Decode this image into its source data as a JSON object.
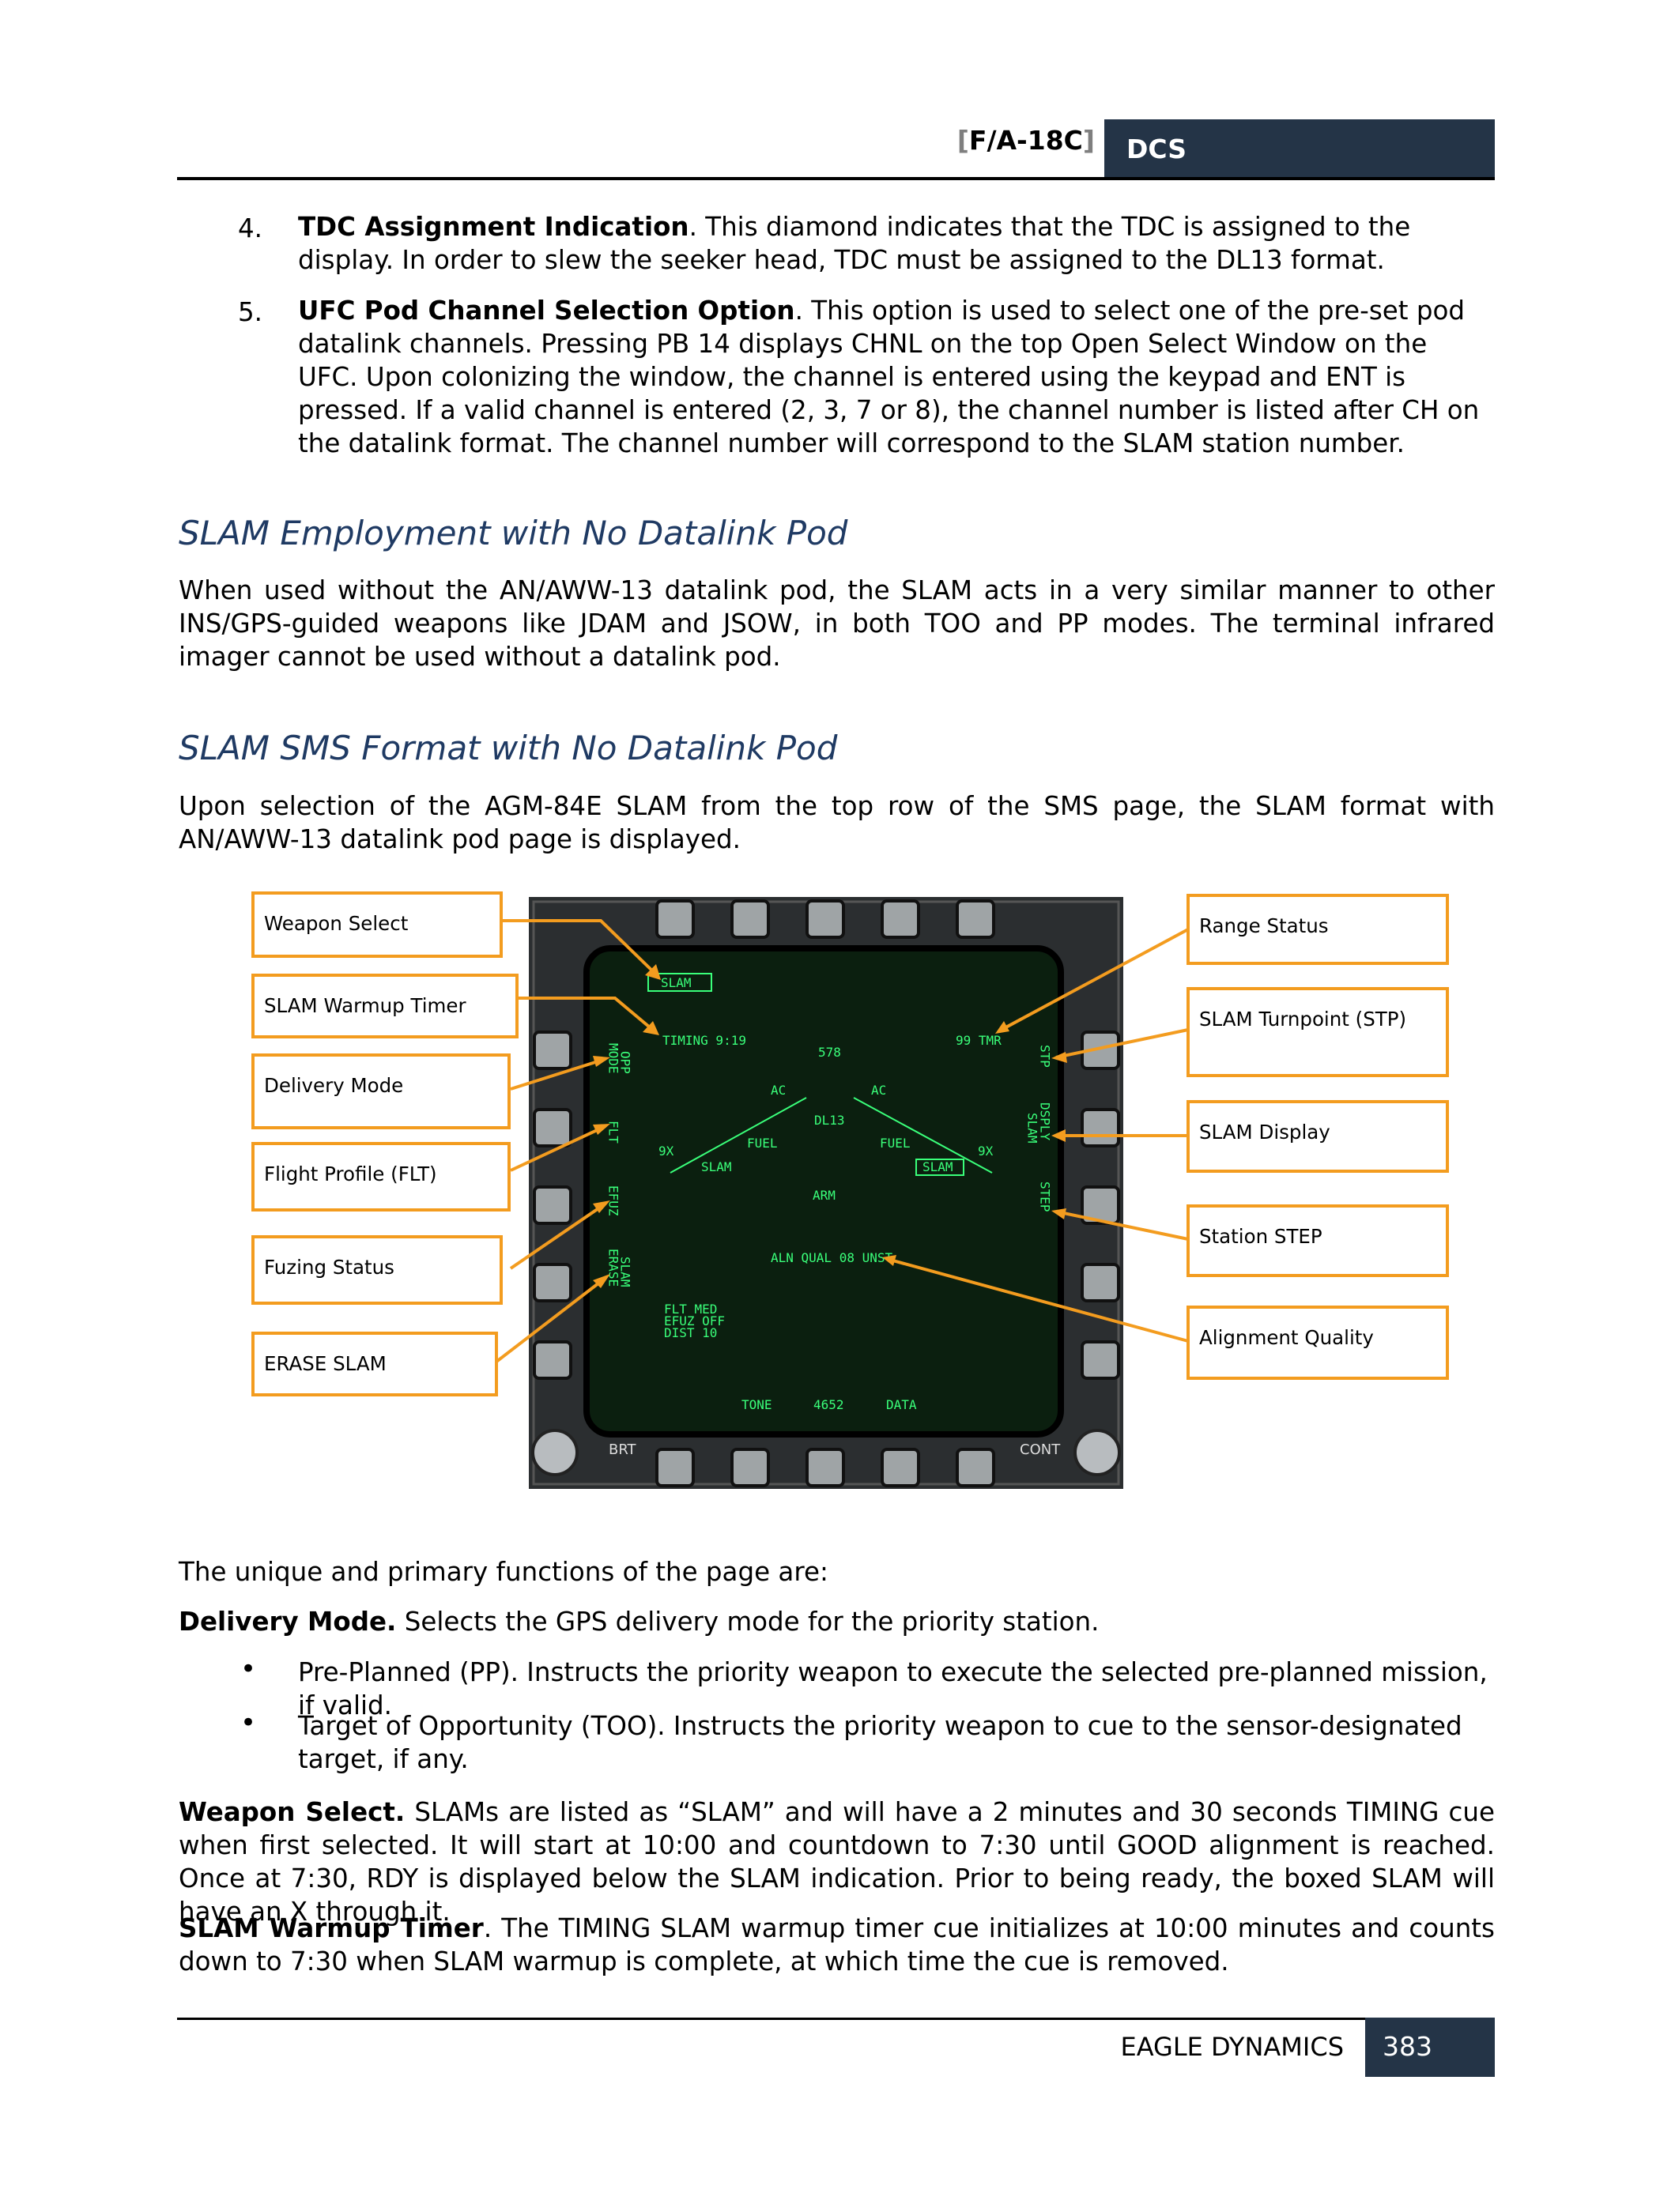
{
  "header": {
    "title": "F/A-18C",
    "bracket_open": "[",
    "bracket_close": "]",
    "badge": "DCS"
  },
  "items": [
    {
      "num": "4.",
      "bold": "TDC Assignment Indication",
      "text": ". This diamond indicates that the TDC is assigned to the display. In order to slew the seeker head, TDC must be assigned to the DL13 format."
    },
    {
      "num": "5.",
      "bold": "UFC Pod Channel Selection Option",
      "text": ". This option is used to select one of the pre-set pod datalink channels. Pressing PB 14 displays CHNL on the top Open Select Window on the UFC. Upon colonizing the window, the channel is entered using the keypad and ENT is pressed. If a valid channel is entered (2, 3, 7 or 8), the channel number is listed after CH on the datalink format. The channel number will correspond to the SLAM station number."
    }
  ],
  "section1": {
    "heading": "SLAM Employment with No Datalink Pod",
    "body": "When used without the AN/AWW-13 datalink pod, the SLAM acts in a very similar manner to other INS/GPS-guided weapons like JDAM and JSOW, in both TOO and PP modes. The terminal infrared imager cannot be used without a datalink pod."
  },
  "section2": {
    "heading": "SLAM SMS Format with No Datalink Pod",
    "body": "Upon selection of the AGM-84E SLAM from the top row of the SMS page, the SLAM format with AN/AWW-13 datalink pod page is displayed."
  },
  "callouts_left": [
    "Weapon Select",
    "SLAM Warmup Timer",
    "Delivery Mode",
    "Flight Profile (FLT)",
    "Fuzing Status",
    "ERASE SLAM"
  ],
  "callouts_right": [
    "Range Status",
    "SLAM Turnpoint (STP)",
    "SLAM Display",
    "Station STEP",
    "Alignment Quality"
  ],
  "ddi": {
    "slam_box": "SLAM",
    "timing": "TIMING 9:19",
    "heading_value": "578",
    "range": "99 TMR",
    "ac_left": "AC",
    "ac_right": "AC",
    "dl": "DL13",
    "fuel_left": "FUEL",
    "fuel_right": "FUEL",
    "nine_left": "9X",
    "nine_right": "9X",
    "slam_left": "SLAM",
    "slam_right": "SLAM",
    "arm": "ARM",
    "aln": "ALN QUAL 08 UNST",
    "flt": "FLT  MED",
    "efuz": "EFUZ OFF",
    "dist": "DIST 10",
    "mode": "MODE",
    "opp": "OPP",
    "flt_side": "FLT",
    "efuz_side": "EFUZ",
    "erase": "ERASE",
    "slam_side": "SLAM",
    "stp": "STP",
    "dsply": "DSPLY",
    "slam_right_side": "SLAM",
    "step": "STEP",
    "tone": "TONE",
    "bottom_num": "4652",
    "data": "DATA",
    "brt": "BRT",
    "cont": "CONT"
  },
  "after_figure": "The unique and primary functions of the page are:",
  "delivery_mode": {
    "bold": "Delivery Mode.",
    "text": " Selects the GPS delivery mode for the priority station."
  },
  "bullets": [
    "Pre-Planned (PP). Instructs the priority weapon to execute the selected pre-planned mission, if valid.",
    "Target of Opportunity (TOO). Instructs the priority weapon to cue to the sensor-designated target, if any."
  ],
  "weapon_select": {
    "bold": "Weapon Select.",
    "text": " SLAMs are listed as “SLAM” and will have a 2 minutes and 30 seconds TIMING cue when first selected. It will start at 10:00 and countdown to 7:30 until GOOD alignment is reached. Once at 7:30, RDY is displayed below the SLAM indication. Prior to being ready, the boxed SLAM will have an X through it."
  },
  "warmup": {
    "bold": "SLAM Warmup Timer",
    "text": ". The TIMING SLAM warmup timer cue initializes at 10:00 minutes and counts down to 7:30 when SLAM warmup is complete, at which time the cue is removed."
  },
  "footer": {
    "company": "EAGLE DYNAMICS",
    "page": "383"
  }
}
